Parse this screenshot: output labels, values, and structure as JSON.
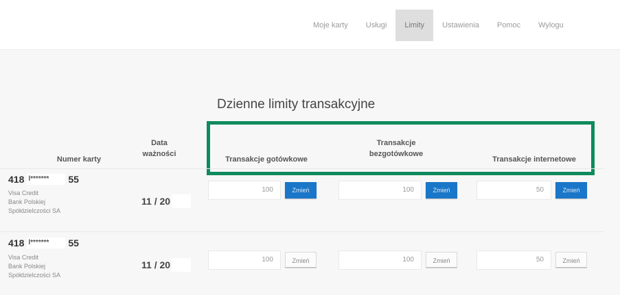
{
  "nav": {
    "items": [
      {
        "label": "Moje karty"
      },
      {
        "label": "Usługi"
      },
      {
        "label": "Limity",
        "active": true
      },
      {
        "label": "Ustawienia"
      },
      {
        "label": "Pomoc"
      },
      {
        "label": "Wylogu"
      }
    ]
  },
  "section": {
    "title": "Dzienne limity transakcyjne"
  },
  "columns": {
    "card_number": "Numer karty",
    "expiry_line1": "Data",
    "expiry_line2": "ważności",
    "cash": "Transakcje gotówkowe",
    "cashless_line1": "Transakcje",
    "cashless_line2": "bezgotówkowe",
    "internet": "Transakcje internetowe"
  },
  "rows": [
    {
      "card_prefix": "418",
      "card_masked": "l*******",
      "card_suffix": "55",
      "card_type": "Visa Credit",
      "bank_line1": "Bank Polskiej",
      "bank_line2": "Spółdzielczości SA",
      "expiry": "11 / 20",
      "cash_limit": "100",
      "cashless_limit": "100",
      "internet_limit": "50",
      "button_label": "Zmień",
      "button_style": "primary"
    },
    {
      "card_prefix": "418",
      "card_masked": "l*******",
      "card_suffix": "55",
      "card_type": "Visa Credit",
      "bank_line1": "Bank Polskiej",
      "bank_line2": "Spółdzielczości SA",
      "expiry": "11 / 20",
      "cash_limit": "100",
      "cashless_limit": "100",
      "internet_limit": "50",
      "button_label": "Zmień",
      "button_style": "secondary"
    }
  ],
  "colors": {
    "highlight_border": "#0f8a5c",
    "primary_button": "#1a76c8",
    "active_tab": "#dedede"
  }
}
